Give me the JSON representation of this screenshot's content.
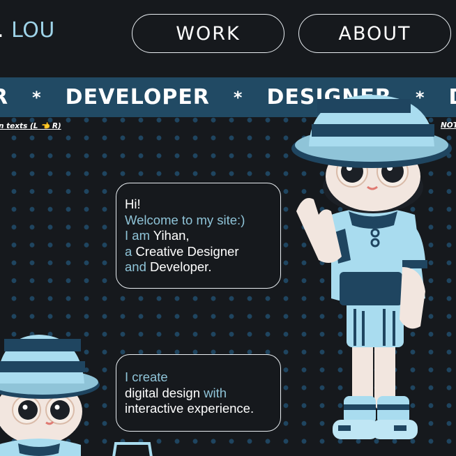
{
  "header": {
    "logo_dot": ".",
    "logo_text": "LOU",
    "nav": {
      "work_label": "WORK",
      "about_label": "ABOUT"
    }
  },
  "marquee": {
    "items": [
      "R",
      "DEVELOPER",
      "DESIGNER",
      "D"
    ],
    "separator": "*"
  },
  "hints": {
    "left": "n texts (L 👈 R)",
    "right": "NOT"
  },
  "intro_bubble": {
    "line1": "Hi!",
    "line2": "Welcome to my site:)",
    "line3_prefix": "I am ",
    "line3_name": "Yihan,",
    "line4_prefix": "a ",
    "line4_role1": "Creative Designer",
    "line5_prefix": "and ",
    "line5_role2": "Developer."
  },
  "create_bubble": {
    "line1": "I create",
    "line2_main": "digital design ",
    "line2_accent": "with",
    "line3": "interactive experience."
  },
  "colors": {
    "background": "#16191d",
    "accent": "#8fc4d8",
    "marquee_bg": "#214a64",
    "dot": "#1f4560"
  }
}
